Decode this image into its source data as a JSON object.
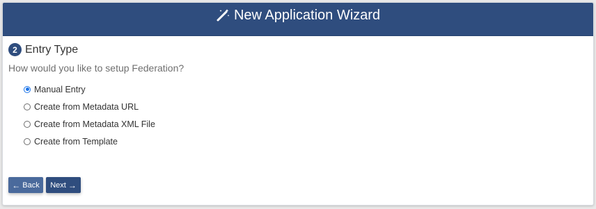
{
  "header": {
    "title": "New Application Wizard",
    "icon": "magic-wand-icon",
    "background": "#2f4d7e"
  },
  "step": {
    "number": "2",
    "title": "Entry Type"
  },
  "question": "How would you like to setup Federation?",
  "options": [
    {
      "label": "Manual Entry",
      "checked": true
    },
    {
      "label": "Create from Metadata URL",
      "checked": false
    },
    {
      "label": "Create from Metadata XML File",
      "checked": false
    },
    {
      "label": "Create from Template",
      "checked": false
    }
  ],
  "buttons": {
    "back_label": "Back",
    "back_icon": "arrow-left-icon",
    "next_label": "Next",
    "next_icon": "arrow-right-icon"
  },
  "accent_color": "#1a73e8"
}
